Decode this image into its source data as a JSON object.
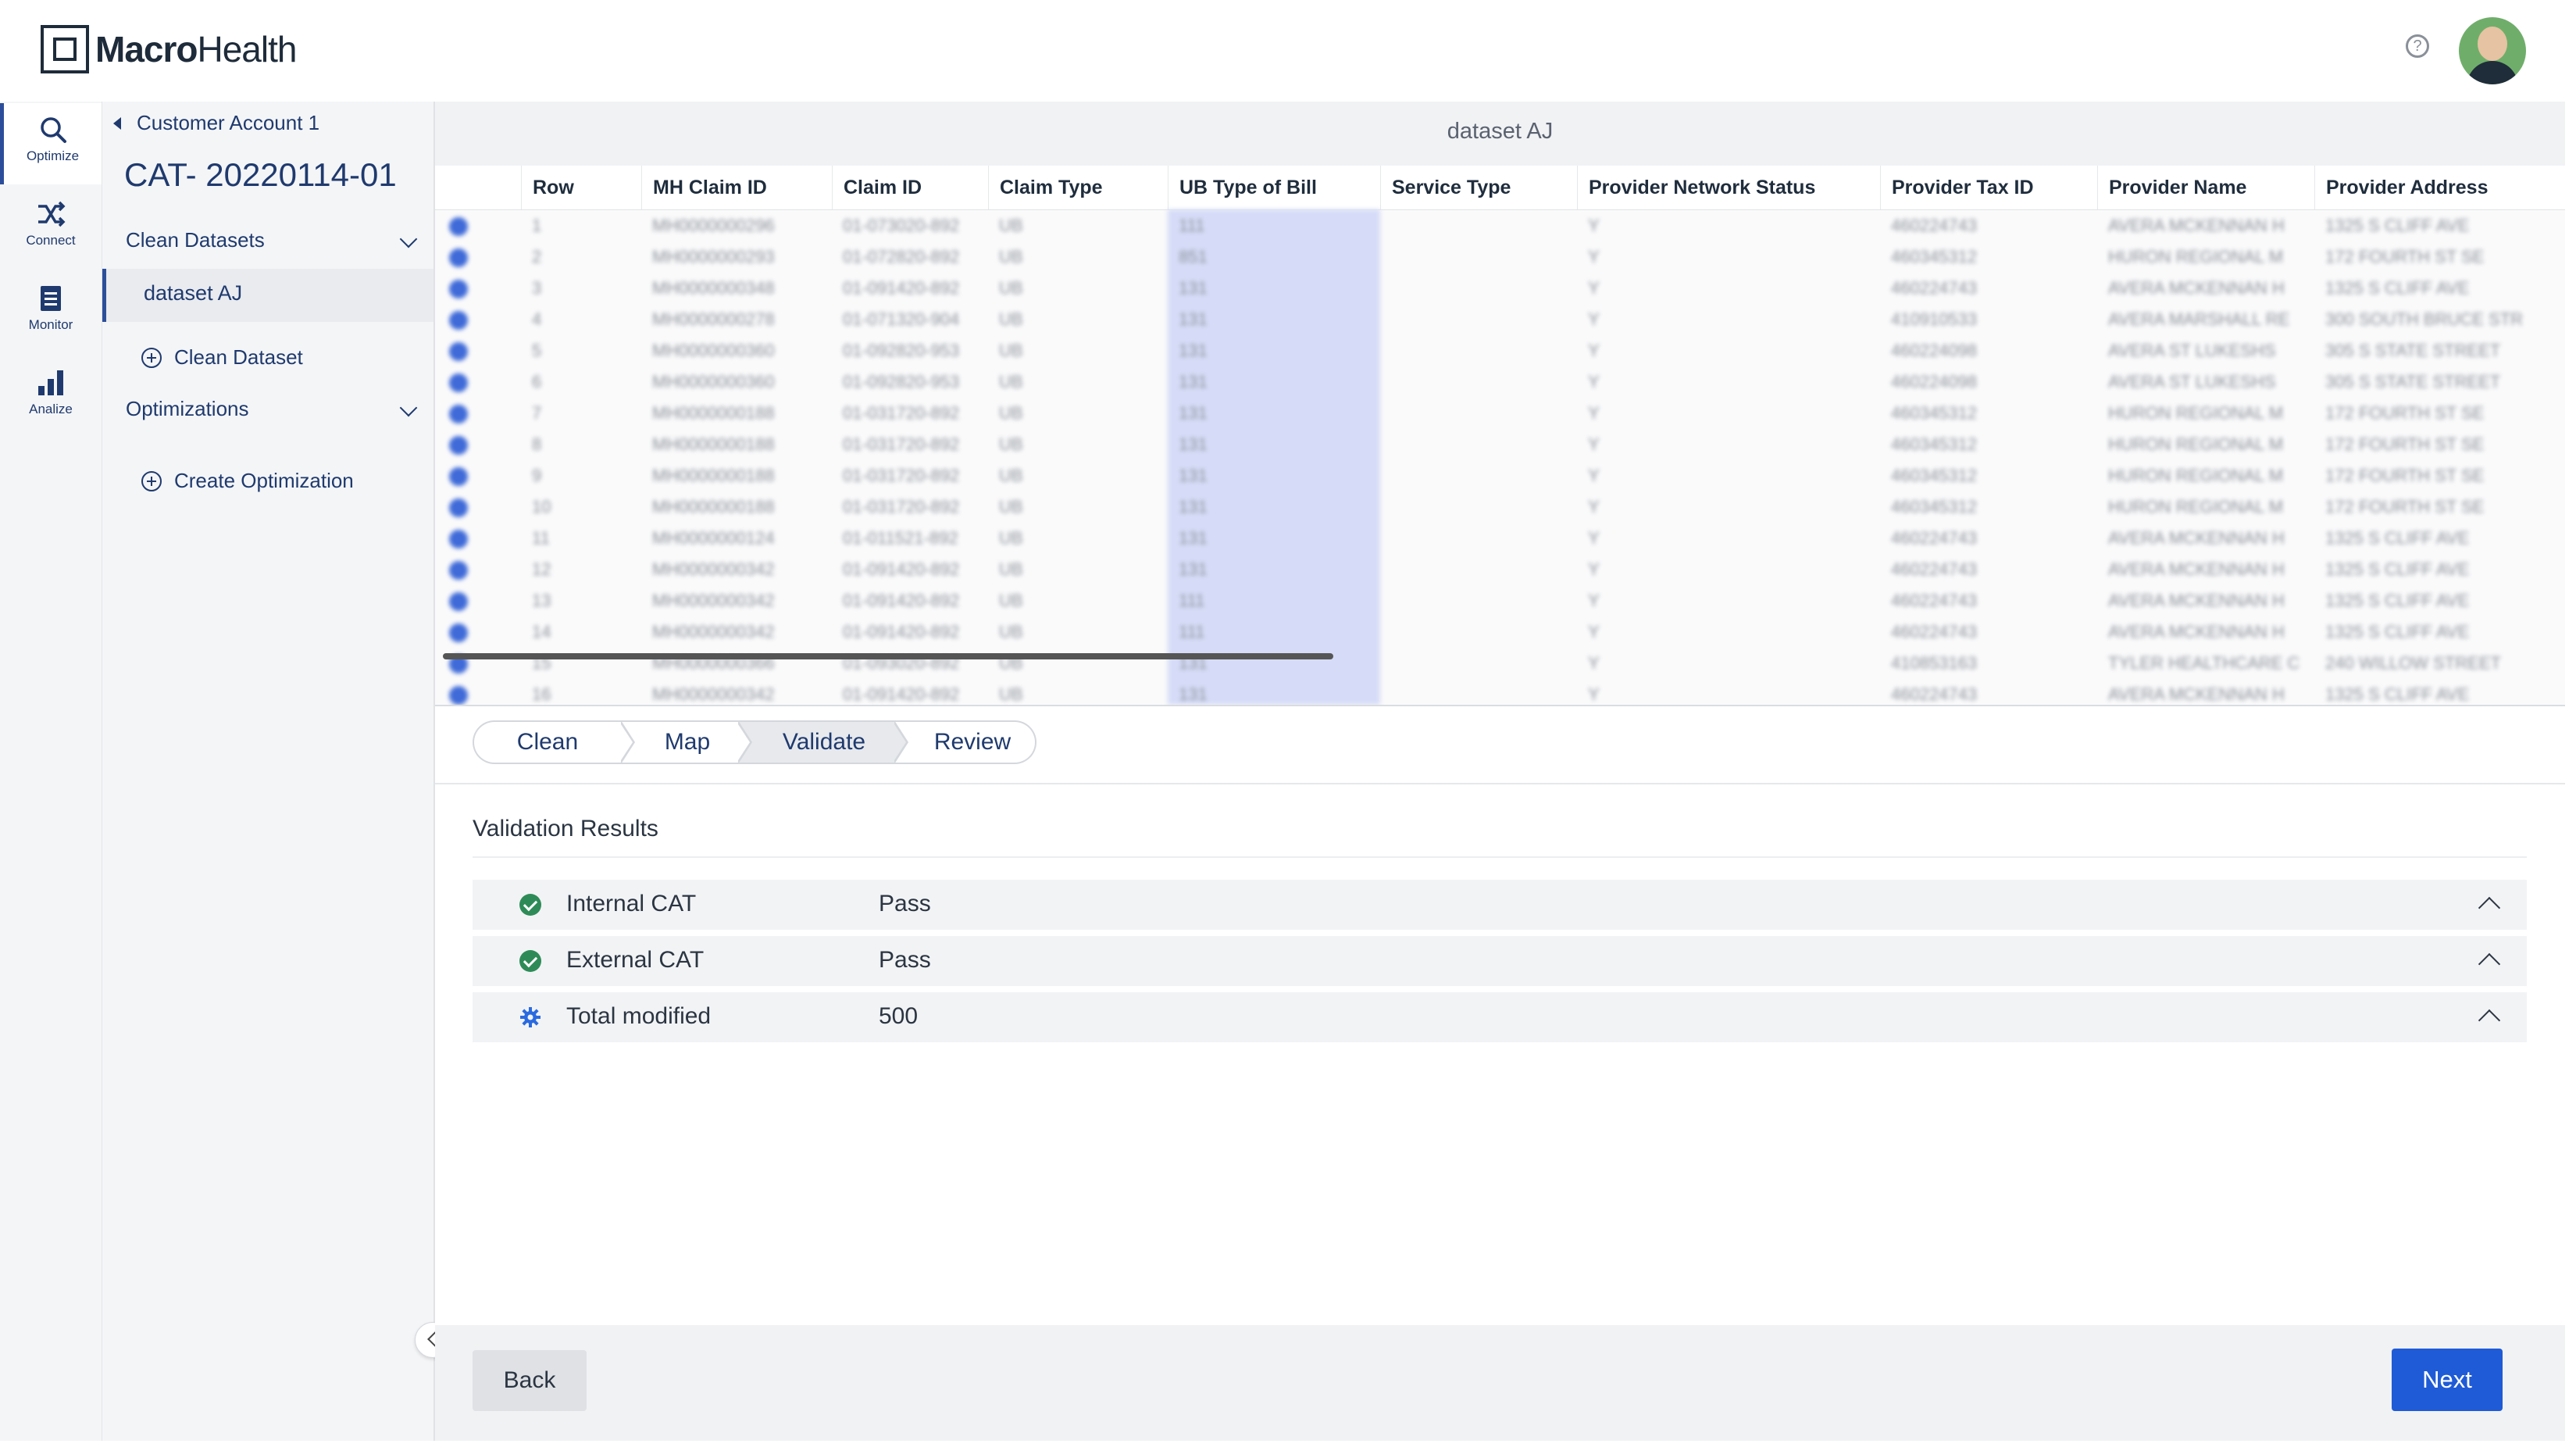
{
  "brand": {
    "bold": "Macro",
    "light": "Health"
  },
  "rail": [
    {
      "label": "Optimize",
      "icon": "search-icon"
    },
    {
      "label": "Connect",
      "icon": "shuffle-icon"
    },
    {
      "label": "Monitor",
      "icon": "monitor-icon"
    },
    {
      "label": "Analize",
      "icon": "bar-chart-icon"
    }
  ],
  "nav": {
    "back": "Customer Account 1",
    "title": "CAT- 20220114-01",
    "clean_datasets": "Clean Datasets",
    "selected_dataset": "dataset AJ",
    "add_clean": "Clean Dataset",
    "optimizations": "Optimizations",
    "add_optimization": "Create Optimization"
  },
  "dataset_title": "dataset AJ",
  "grid": {
    "columns": [
      "Row",
      "MH Claim ID",
      "Claim ID",
      "Claim Type",
      "UB Type of Bill",
      "Service Type",
      "Provider Network Status",
      "Provider Tax ID",
      "Provider Name",
      "Provider Address"
    ],
    "rows": [
      [
        "1",
        "MH0000000296",
        "01-073020-892",
        "UB",
        "111",
        "",
        "Y",
        "460224743",
        "AVERA MCKENNAN H",
        "1325 S CLIFF AVE"
      ],
      [
        "2",
        "MH0000000293",
        "01-072820-892",
        "UB",
        "851",
        "",
        "Y",
        "460345312",
        "HURON REGIONAL M",
        "172 FOURTH ST SE"
      ],
      [
        "3",
        "MH0000000348",
        "01-091420-892",
        "UB",
        "131",
        "",
        "Y",
        "460224743",
        "AVERA MCKENNAN H",
        "1325 S CLIFF AVE"
      ],
      [
        "4",
        "MH0000000278",
        "01-071320-904",
        "UB",
        "131",
        "",
        "Y",
        "410910533",
        "AVERA MARSHALL RE",
        "300 SOUTH BRUCE STR"
      ],
      [
        "5",
        "MH0000000360",
        "01-092820-953",
        "UB",
        "131",
        "",
        "Y",
        "460224098",
        "AVERA ST LUKESHS",
        "305 S STATE STREET"
      ],
      [
        "6",
        "MH0000000360",
        "01-092820-953",
        "UB",
        "131",
        "",
        "Y",
        "460224098",
        "AVERA ST LUKESHS",
        "305 S STATE STREET"
      ],
      [
        "7",
        "MH0000000188",
        "01-031720-892",
        "UB",
        "131",
        "",
        "Y",
        "460345312",
        "HURON REGIONAL M",
        "172 FOURTH ST SE"
      ],
      [
        "8",
        "MH0000000188",
        "01-031720-892",
        "UB",
        "131",
        "",
        "Y",
        "460345312",
        "HURON REGIONAL M",
        "172 FOURTH ST SE"
      ],
      [
        "9",
        "MH0000000188",
        "01-031720-892",
        "UB",
        "131",
        "",
        "Y",
        "460345312",
        "HURON REGIONAL M",
        "172 FOURTH ST SE"
      ],
      [
        "10",
        "MH0000000188",
        "01-031720-892",
        "UB",
        "131",
        "",
        "Y",
        "460345312",
        "HURON REGIONAL M",
        "172 FOURTH ST SE"
      ],
      [
        "11",
        "MH0000000124",
        "01-011521-892",
        "UB",
        "131",
        "",
        "Y",
        "460224743",
        "AVERA MCKENNAN H",
        "1325 S CLIFF AVE"
      ],
      [
        "12",
        "MH0000000342",
        "01-091420-892",
        "UB",
        "131",
        "",
        "Y",
        "460224743",
        "AVERA MCKENNAN H",
        "1325 S CLIFF AVE"
      ],
      [
        "13",
        "MH0000000342",
        "01-091420-892",
        "UB",
        "111",
        "",
        "Y",
        "460224743",
        "AVERA MCKENNAN H",
        "1325 S CLIFF AVE"
      ],
      [
        "14",
        "MH0000000342",
        "01-091420-892",
        "UB",
        "111",
        "",
        "Y",
        "460224743",
        "AVERA MCKENNAN H",
        "1325 S CLIFF AVE"
      ],
      [
        "15",
        "MH0000000366",
        "01-093020-892",
        "UB",
        "131",
        "",
        "Y",
        "410853163",
        "TYLER HEALTHCARE C",
        "240 WILLOW STREET"
      ],
      [
        "16",
        "MH0000000342",
        "01-091420-892",
        "UB",
        "131",
        "",
        "Y",
        "460224743",
        "AVERA MCKENNAN H",
        "1325 S CLIFF AVE"
      ]
    ]
  },
  "steps": [
    "Clean",
    "Map",
    "Validate",
    "Review"
  ],
  "active_step": "Validate",
  "validation": {
    "title": "Validation Results",
    "results": [
      {
        "name": "Internal CAT",
        "value": "Pass",
        "icon": "check-circle-icon"
      },
      {
        "name": "External CAT",
        "value": "Pass",
        "icon": "check-circle-icon"
      },
      {
        "name": "Total modified",
        "value": "500",
        "icon": "gear-icon"
      }
    ]
  },
  "footer": {
    "back": "Back",
    "next": "Next"
  },
  "colors": {
    "primary": "#1f5bd6",
    "nav_text": "#1f3a6e",
    "pass": "#2e8b57"
  }
}
